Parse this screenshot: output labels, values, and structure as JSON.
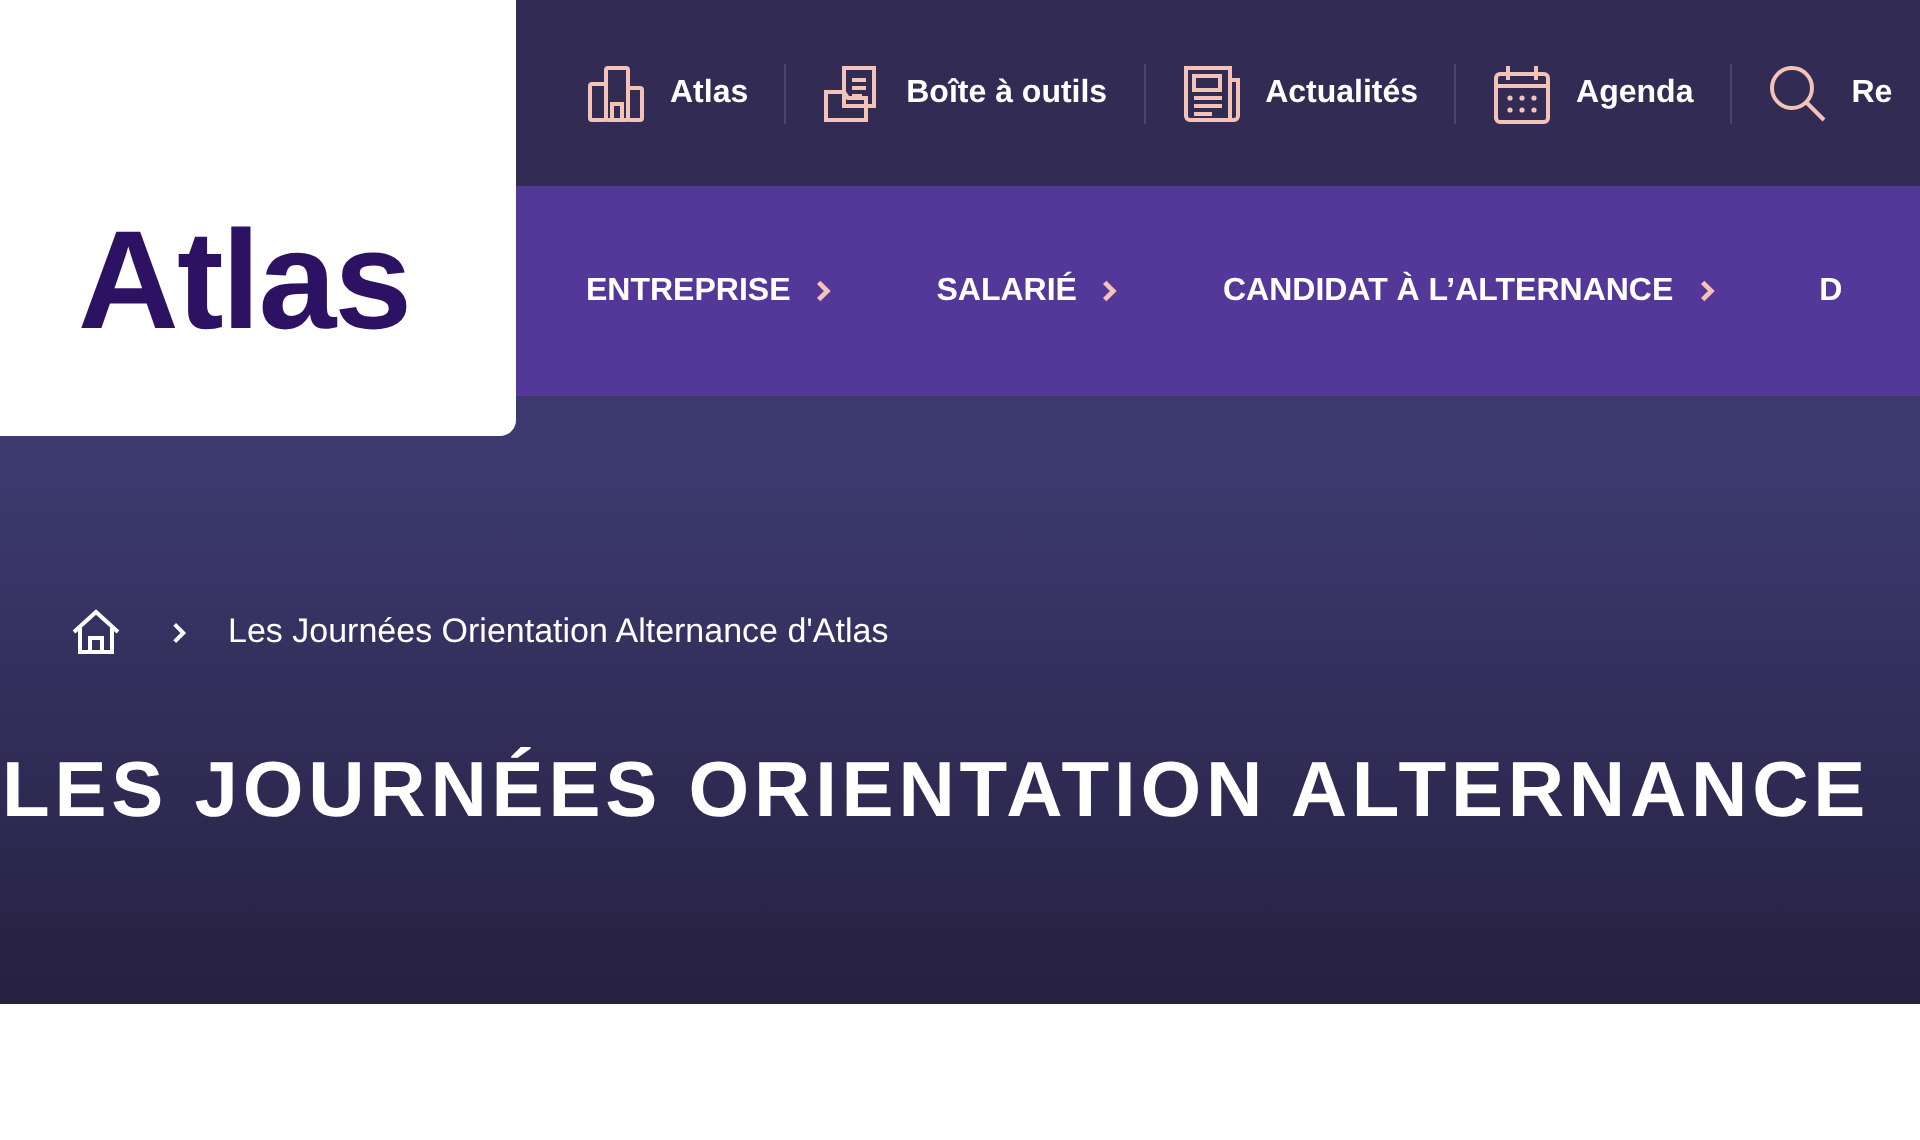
{
  "logo": "Atlas",
  "utility_links": [
    {
      "label": "Atlas"
    },
    {
      "label": "Boîte à outils"
    },
    {
      "label": "Actualités"
    },
    {
      "label": "Agenda"
    },
    {
      "label": "Re"
    }
  ],
  "main_nav": [
    {
      "label": "ENTREPRISE",
      "has_submenu": true
    },
    {
      "label": "SALARIÉ",
      "has_submenu": true
    },
    {
      "label": "CANDIDAT À L’ALTERNANCE",
      "has_submenu": true
    },
    {
      "label": "D",
      "has_submenu": false
    }
  ],
  "breadcrumb": {
    "current": "Les Journées Orientation Alternance d'Atlas"
  },
  "title": "LES JOURNÉES ORIENTATION ALTERNANCE"
}
